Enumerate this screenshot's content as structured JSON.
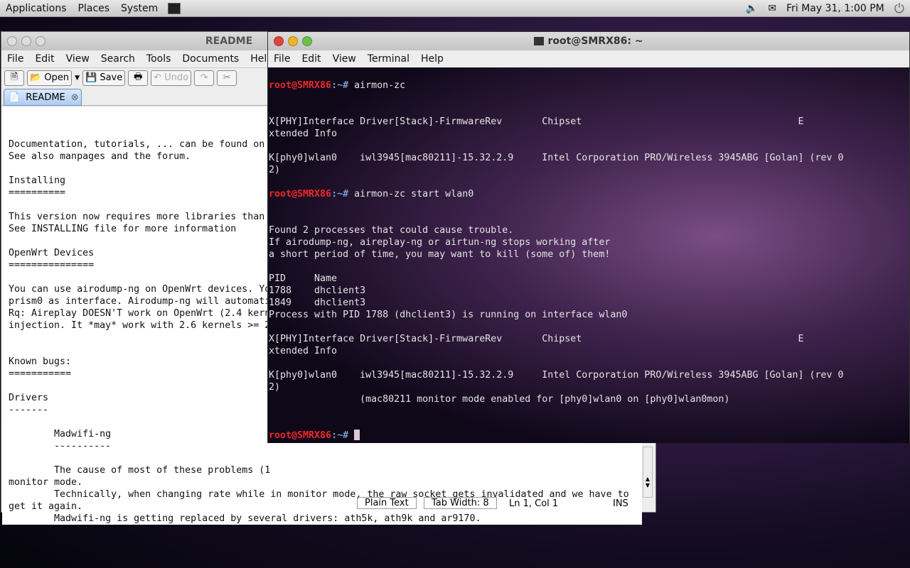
{
  "panel": {
    "menus": [
      "Applications",
      "Places",
      "System"
    ],
    "clock": "Fri May 31,  1:00 PM"
  },
  "editor": {
    "title": "README",
    "menus": [
      "File",
      "Edit",
      "View",
      "Search",
      "Tools",
      "Documents",
      "Help"
    ],
    "toolbar": {
      "open": "Open",
      "save": "Save",
      "undo": "Undo"
    },
    "tab": "README",
    "lines": [
      "Documentation, tutorials, ... can be found on",
      "See also manpages and the forum.",
      "",
      "Installing",
      "==========",
      "",
      "This version now requires more libraries than",
      "See INSTALLING file for more information",
      "",
      "OpenWrt Devices",
      "===============",
      "",
      "You can use airodump-ng on OpenWrt devices. Yo",
      "prism0 as interface. Airodump-ng will automati",
      "Rq: Aireplay DOESN'T work on OpenWrt (2.4 kern",
      "injection. It *may* work with 2.6 kernels >= 2",
      "",
      "",
      "Known bugs:",
      "===========",
      "",
      "Drivers",
      "-------",
      "",
      "        Madwifi-ng",
      "        ----------",
      "",
      "        The cause of most of these problems (1",
      "monitor mode.",
      "        Technically, when changing rate while in monitor mode, the raw socket gets invalidated and we have to",
      "get it again.",
      "        Madwifi-ng is getting replaced by several drivers: ath5k, ath9k and ar9170."
    ],
    "status": {
      "mode": "Plain Text",
      "tab_width": "Tab Width:  8",
      "position": "Ln 1, Col 1",
      "ins": "INS"
    }
  },
  "terminal": {
    "title": "root@SMRX86: ~",
    "menus": [
      "File",
      "Edit",
      "View",
      "Terminal",
      "Help"
    ],
    "prompt_user": "root@SMRX86",
    "prompt_path": ":~#",
    "lines": [
      {
        "p": true,
        "t": " airmon-zc"
      },
      {
        "t": ""
      },
      {
        "t": ""
      },
      {
        "t": "X[PHY]Interface Driver[Stack]-FirmwareRev       Chipset                                      E"
      },
      {
        "t": "xtended Info"
      },
      {
        "t": ""
      },
      {
        "t": "K[phy0]wlan0    iwl3945[mac80211]-15.32.2.9     Intel Corporation PRO/Wireless 3945ABG [Golan] (rev 0"
      },
      {
        "t": "2)"
      },
      {
        "t": ""
      },
      {
        "p": true,
        "t": " airmon-zc start wlan0"
      },
      {
        "t": ""
      },
      {
        "t": ""
      },
      {
        "t": "Found 2 processes that could cause trouble."
      },
      {
        "t": "If airodump-ng, aireplay-ng or airtun-ng stops working after"
      },
      {
        "t": "a short period of time, you may want to kill (some of) them!"
      },
      {
        "t": ""
      },
      {
        "t": "PID     Name"
      },
      {
        "t": "1788    dhclient3"
      },
      {
        "t": "1849    dhclient3"
      },
      {
        "t": "Process with PID 1788 (dhclient3) is running on interface wlan0"
      },
      {
        "t": ""
      },
      {
        "t": "X[PHY]Interface Driver[Stack]-FirmwareRev       Chipset                                      E"
      },
      {
        "t": "xtended Info"
      },
      {
        "t": ""
      },
      {
        "t": "K[phy0]wlan0    iwl3945[mac80211]-15.32.2.9     Intel Corporation PRO/Wireless 3945ABG [Golan] (rev 0"
      },
      {
        "t": "2)"
      },
      {
        "t": "                (mac80211 monitor mode enabled for [phy0]wlan0 on [phy0]wlan0mon)"
      },
      {
        "t": ""
      },
      {
        "t": ""
      },
      {
        "p": true,
        "t": " ",
        "cursor": true
      }
    ]
  }
}
